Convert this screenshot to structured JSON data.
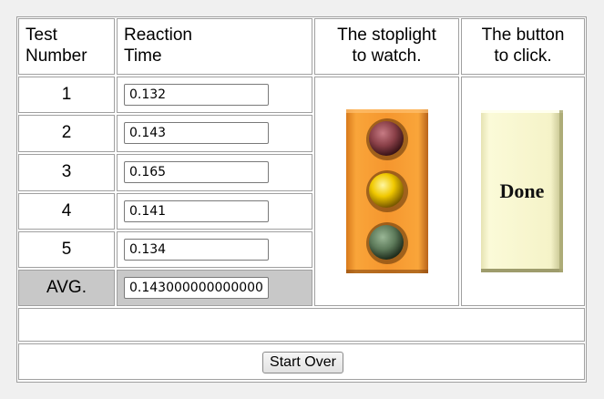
{
  "headers": {
    "test_number": [
      "Test",
      "Number"
    ],
    "reaction_time": [
      "Reaction",
      "Time"
    ],
    "stoplight": [
      "The stoplight",
      "to watch."
    ],
    "button": [
      "The button",
      "to click."
    ]
  },
  "rows": [
    {
      "number": "1",
      "time": "0.132"
    },
    {
      "number": "2",
      "time": "0.143"
    },
    {
      "number": "3",
      "time": "0.165"
    },
    {
      "number": "4",
      "time": "0.141"
    },
    {
      "number": "5",
      "time": "0.134"
    }
  ],
  "average": {
    "label": "AVG.",
    "value": "0.143000000000000"
  },
  "done_button": {
    "label": "Done"
  },
  "start_over_label": "Start Over",
  "stoplight": {
    "state": "all-off"
  },
  "colors": {
    "stoplight_housing": "#f5962e",
    "light_red": "#8a4048",
    "light_yellow": "#f0c800",
    "light_green": "#5d7a5a",
    "done_button_face": "#f7f5cf",
    "avg_row_bg": "#c8c8c8"
  },
  "status_message": ""
}
